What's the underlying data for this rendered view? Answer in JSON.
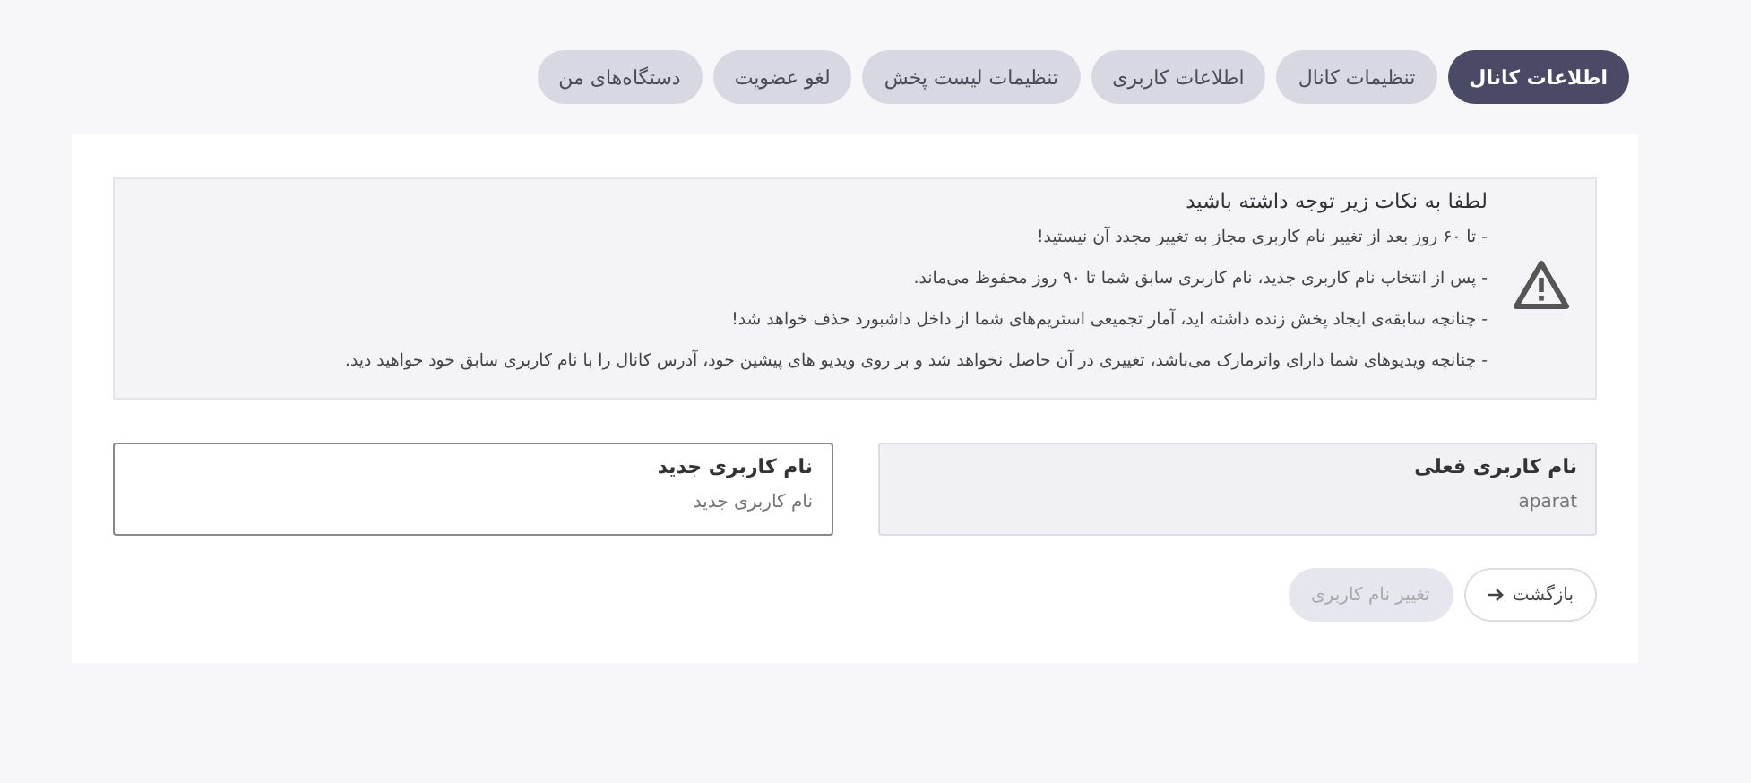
{
  "tabs": [
    {
      "label": "اطلاعات کانال",
      "selected": true
    },
    {
      "label": "تنظیمات کانال",
      "selected": false
    },
    {
      "label": "اطلاعات کاربری",
      "selected": false
    },
    {
      "label": "تنظیمات لیست پخش",
      "selected": false
    },
    {
      "label": "لغو عضویت",
      "selected": false
    },
    {
      "label": "دستگاه‌های من",
      "selected": false
    }
  ],
  "notice": {
    "title": "لطفا به نکات زیر توجه داشته باشید",
    "items": [
      "- تا ۶۰ روز بعد از تغییر نام کاربری مجاز به تغییر مجدد آن نیستید!",
      "- پس از انتخاب نام کاربری جدید، نام کاربری سابق شما تا ۹۰ روز محفوظ می‌ماند.",
      "- چنانچه سابقه‌ی ایجاد پخش زنده داشته اید، آمار تجمیعی استریم‌های شما از داخل داشبورد حذف خواهد شد!",
      "- چنانچه ویدیوهای شما دارای واترمارک می‌باشد، تغییری در آن حاصل نخواهد شد و بر روی ویدیو های پیشین خود، آدرس کانال را با نام کاربری سابق خود خواهید دید."
    ]
  },
  "fields": [
    {
      "label": "نام کاربری فعلی",
      "value": "aparat",
      "disabled": true
    },
    {
      "label": "نام کاربری جدید",
      "placeholder": "نام کاربری جدید",
      "disabled": false
    }
  ],
  "buttons": [
    {
      "label": "بازگشت",
      "kind": "back",
      "disabled": false
    },
    {
      "label": "تغییر نام کاربری",
      "kind": "submit",
      "disabled": true
    }
  ]
}
